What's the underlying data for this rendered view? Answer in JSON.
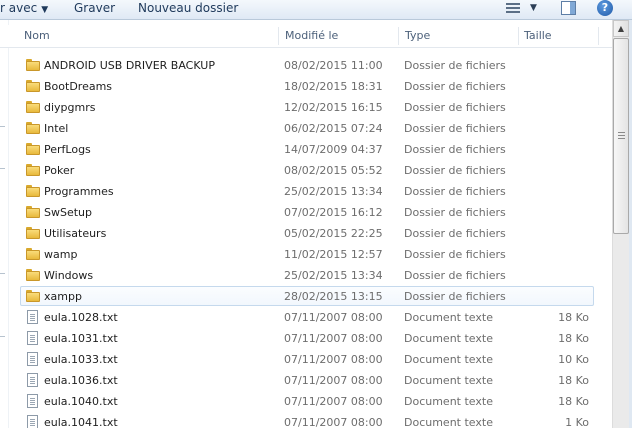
{
  "toolbar": {
    "open_with_label": "r avec",
    "burn_label": "Graver",
    "new_folder_label": "Nouveau dossier",
    "help_glyph": "?",
    "icons": [
      "chevron-down-icon",
      "views-icon",
      "preview-pane-icon",
      "help-icon"
    ]
  },
  "columns": {
    "name": "Nom",
    "modified": "Modifié le",
    "type": "Type",
    "size": "Taille"
  },
  "files": [
    {
      "name": "ANDROID USB DRIVER BACKUP",
      "modified": "08/02/2015 11:00",
      "type": "Dossier de fichiers",
      "size": "",
      "kind": "folder"
    },
    {
      "name": "BootDreams",
      "modified": "18/02/2015 18:31",
      "type": "Dossier de fichiers",
      "size": "",
      "kind": "folder"
    },
    {
      "name": "diypgmrs",
      "modified": "12/02/2015 16:15",
      "type": "Dossier de fichiers",
      "size": "",
      "kind": "folder"
    },
    {
      "name": "Intel",
      "modified": "06/02/2015 07:24",
      "type": "Dossier de fichiers",
      "size": "",
      "kind": "folder"
    },
    {
      "name": "PerfLogs",
      "modified": "14/07/2009 04:37",
      "type": "Dossier de fichiers",
      "size": "",
      "kind": "folder"
    },
    {
      "name": "Poker",
      "modified": "08/02/2015 05:52",
      "type": "Dossier de fichiers",
      "size": "",
      "kind": "folder"
    },
    {
      "name": "Programmes",
      "modified": "25/02/2015 13:34",
      "type": "Dossier de fichiers",
      "size": "",
      "kind": "folder"
    },
    {
      "name": "SwSetup",
      "modified": "07/02/2015 16:12",
      "type": "Dossier de fichiers",
      "size": "",
      "kind": "folder"
    },
    {
      "name": "Utilisateurs",
      "modified": "05/02/2015 22:25",
      "type": "Dossier de fichiers",
      "size": "",
      "kind": "folder"
    },
    {
      "name": "wamp",
      "modified": "11/02/2015 12:57",
      "type": "Dossier de fichiers",
      "size": "",
      "kind": "folder"
    },
    {
      "name": "Windows",
      "modified": "25/02/2015 13:34",
      "type": "Dossier de fichiers",
      "size": "",
      "kind": "folder"
    },
    {
      "name": "xampp",
      "modified": "28/02/2015 13:15",
      "type": "Dossier de fichiers",
      "size": "",
      "kind": "folder",
      "hot": true
    },
    {
      "name": "eula.1028.txt",
      "modified": "07/11/2007 08:00",
      "type": "Document texte",
      "size": "18 Ko",
      "kind": "doc"
    },
    {
      "name": "eula.1031.txt",
      "modified": "07/11/2007 08:00",
      "type": "Document texte",
      "size": "18 Ko",
      "kind": "doc"
    },
    {
      "name": "eula.1033.txt",
      "modified": "07/11/2007 08:00",
      "type": "Document texte",
      "size": "10 Ko",
      "kind": "doc"
    },
    {
      "name": "eula.1036.txt",
      "modified": "07/11/2007 08:00",
      "type": "Document texte",
      "size": "18 Ko",
      "kind": "doc"
    },
    {
      "name": "eula.1040.txt",
      "modified": "07/11/2007 08:00",
      "type": "Document texte",
      "size": "18 Ko",
      "kind": "doc"
    },
    {
      "name": "eula.1041.txt",
      "modified": "07/11/2007 08:00",
      "type": "Document texte",
      "size": "1 Ko",
      "kind": "doc"
    }
  ],
  "scrollbar": {
    "position": 0.0,
    "visible_fraction": 0.5
  }
}
